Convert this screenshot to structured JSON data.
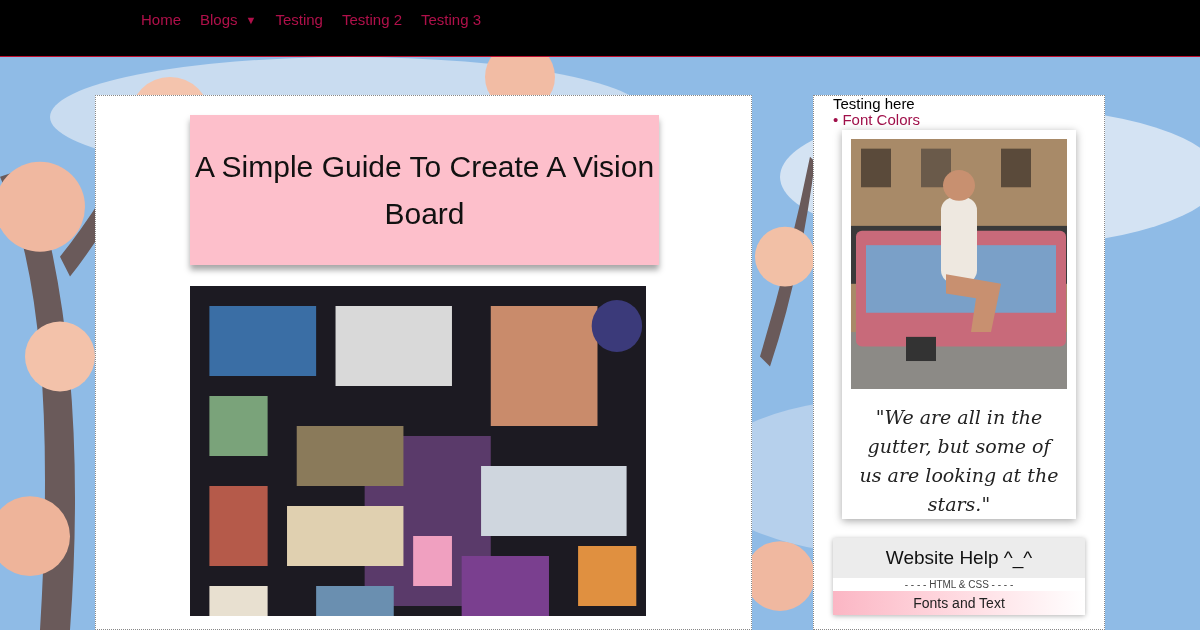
{
  "nav": {
    "items": [
      {
        "label": "Home",
        "kind": "link"
      },
      {
        "label": "Blogs",
        "kind": "dropdown",
        "caret": "▼"
      },
      {
        "label": "Testing",
        "kind": "link"
      },
      {
        "label": "Testing 2",
        "kind": "link"
      },
      {
        "label": "Testing 3",
        "kind": "link"
      }
    ]
  },
  "post": {
    "title": "A Simple Guide To Create A Vision Board"
  },
  "sidebar": {
    "heading": "Testing here",
    "links": [
      {
        "bullet": "•",
        "label": "Font Colors"
      }
    ],
    "polaroid": {
      "caption": "\"We are all in the gutter, but some of us are looking at the stars.\""
    },
    "help": {
      "title": "Website Help ^_^",
      "section": "- - - - HTML & CSS - - - -",
      "items": [
        "Fonts and Text"
      ]
    }
  }
}
